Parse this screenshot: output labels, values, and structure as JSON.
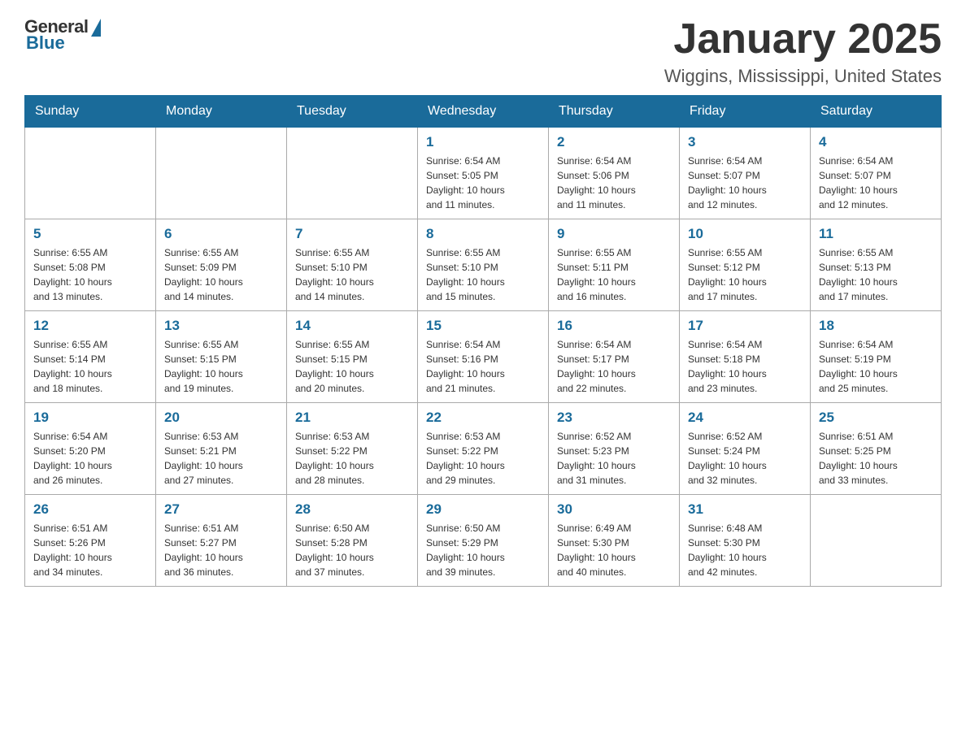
{
  "logo": {
    "general": "General",
    "blue": "Blue"
  },
  "header": {
    "month": "January 2025",
    "location": "Wiggins, Mississippi, United States"
  },
  "weekdays": [
    "Sunday",
    "Monday",
    "Tuesday",
    "Wednesday",
    "Thursday",
    "Friday",
    "Saturday"
  ],
  "weeks": [
    [
      {
        "day": "",
        "info": ""
      },
      {
        "day": "",
        "info": ""
      },
      {
        "day": "",
        "info": ""
      },
      {
        "day": "1",
        "info": "Sunrise: 6:54 AM\nSunset: 5:05 PM\nDaylight: 10 hours\nand 11 minutes."
      },
      {
        "day": "2",
        "info": "Sunrise: 6:54 AM\nSunset: 5:06 PM\nDaylight: 10 hours\nand 11 minutes."
      },
      {
        "day": "3",
        "info": "Sunrise: 6:54 AM\nSunset: 5:07 PM\nDaylight: 10 hours\nand 12 minutes."
      },
      {
        "day": "4",
        "info": "Sunrise: 6:54 AM\nSunset: 5:07 PM\nDaylight: 10 hours\nand 12 minutes."
      }
    ],
    [
      {
        "day": "5",
        "info": "Sunrise: 6:55 AM\nSunset: 5:08 PM\nDaylight: 10 hours\nand 13 minutes."
      },
      {
        "day": "6",
        "info": "Sunrise: 6:55 AM\nSunset: 5:09 PM\nDaylight: 10 hours\nand 14 minutes."
      },
      {
        "day": "7",
        "info": "Sunrise: 6:55 AM\nSunset: 5:10 PM\nDaylight: 10 hours\nand 14 minutes."
      },
      {
        "day": "8",
        "info": "Sunrise: 6:55 AM\nSunset: 5:10 PM\nDaylight: 10 hours\nand 15 minutes."
      },
      {
        "day": "9",
        "info": "Sunrise: 6:55 AM\nSunset: 5:11 PM\nDaylight: 10 hours\nand 16 minutes."
      },
      {
        "day": "10",
        "info": "Sunrise: 6:55 AM\nSunset: 5:12 PM\nDaylight: 10 hours\nand 17 minutes."
      },
      {
        "day": "11",
        "info": "Sunrise: 6:55 AM\nSunset: 5:13 PM\nDaylight: 10 hours\nand 17 minutes."
      }
    ],
    [
      {
        "day": "12",
        "info": "Sunrise: 6:55 AM\nSunset: 5:14 PM\nDaylight: 10 hours\nand 18 minutes."
      },
      {
        "day": "13",
        "info": "Sunrise: 6:55 AM\nSunset: 5:15 PM\nDaylight: 10 hours\nand 19 minutes."
      },
      {
        "day": "14",
        "info": "Sunrise: 6:55 AM\nSunset: 5:15 PM\nDaylight: 10 hours\nand 20 minutes."
      },
      {
        "day": "15",
        "info": "Sunrise: 6:54 AM\nSunset: 5:16 PM\nDaylight: 10 hours\nand 21 minutes."
      },
      {
        "day": "16",
        "info": "Sunrise: 6:54 AM\nSunset: 5:17 PM\nDaylight: 10 hours\nand 22 minutes."
      },
      {
        "day": "17",
        "info": "Sunrise: 6:54 AM\nSunset: 5:18 PM\nDaylight: 10 hours\nand 23 minutes."
      },
      {
        "day": "18",
        "info": "Sunrise: 6:54 AM\nSunset: 5:19 PM\nDaylight: 10 hours\nand 25 minutes."
      }
    ],
    [
      {
        "day": "19",
        "info": "Sunrise: 6:54 AM\nSunset: 5:20 PM\nDaylight: 10 hours\nand 26 minutes."
      },
      {
        "day": "20",
        "info": "Sunrise: 6:53 AM\nSunset: 5:21 PM\nDaylight: 10 hours\nand 27 minutes."
      },
      {
        "day": "21",
        "info": "Sunrise: 6:53 AM\nSunset: 5:22 PM\nDaylight: 10 hours\nand 28 minutes."
      },
      {
        "day": "22",
        "info": "Sunrise: 6:53 AM\nSunset: 5:22 PM\nDaylight: 10 hours\nand 29 minutes."
      },
      {
        "day": "23",
        "info": "Sunrise: 6:52 AM\nSunset: 5:23 PM\nDaylight: 10 hours\nand 31 minutes."
      },
      {
        "day": "24",
        "info": "Sunrise: 6:52 AM\nSunset: 5:24 PM\nDaylight: 10 hours\nand 32 minutes."
      },
      {
        "day": "25",
        "info": "Sunrise: 6:51 AM\nSunset: 5:25 PM\nDaylight: 10 hours\nand 33 minutes."
      }
    ],
    [
      {
        "day": "26",
        "info": "Sunrise: 6:51 AM\nSunset: 5:26 PM\nDaylight: 10 hours\nand 34 minutes."
      },
      {
        "day": "27",
        "info": "Sunrise: 6:51 AM\nSunset: 5:27 PM\nDaylight: 10 hours\nand 36 minutes."
      },
      {
        "day": "28",
        "info": "Sunrise: 6:50 AM\nSunset: 5:28 PM\nDaylight: 10 hours\nand 37 minutes."
      },
      {
        "day": "29",
        "info": "Sunrise: 6:50 AM\nSunset: 5:29 PM\nDaylight: 10 hours\nand 39 minutes."
      },
      {
        "day": "30",
        "info": "Sunrise: 6:49 AM\nSunset: 5:30 PM\nDaylight: 10 hours\nand 40 minutes."
      },
      {
        "day": "31",
        "info": "Sunrise: 6:48 AM\nSunset: 5:30 PM\nDaylight: 10 hours\nand 42 minutes."
      },
      {
        "day": "",
        "info": ""
      }
    ]
  ]
}
